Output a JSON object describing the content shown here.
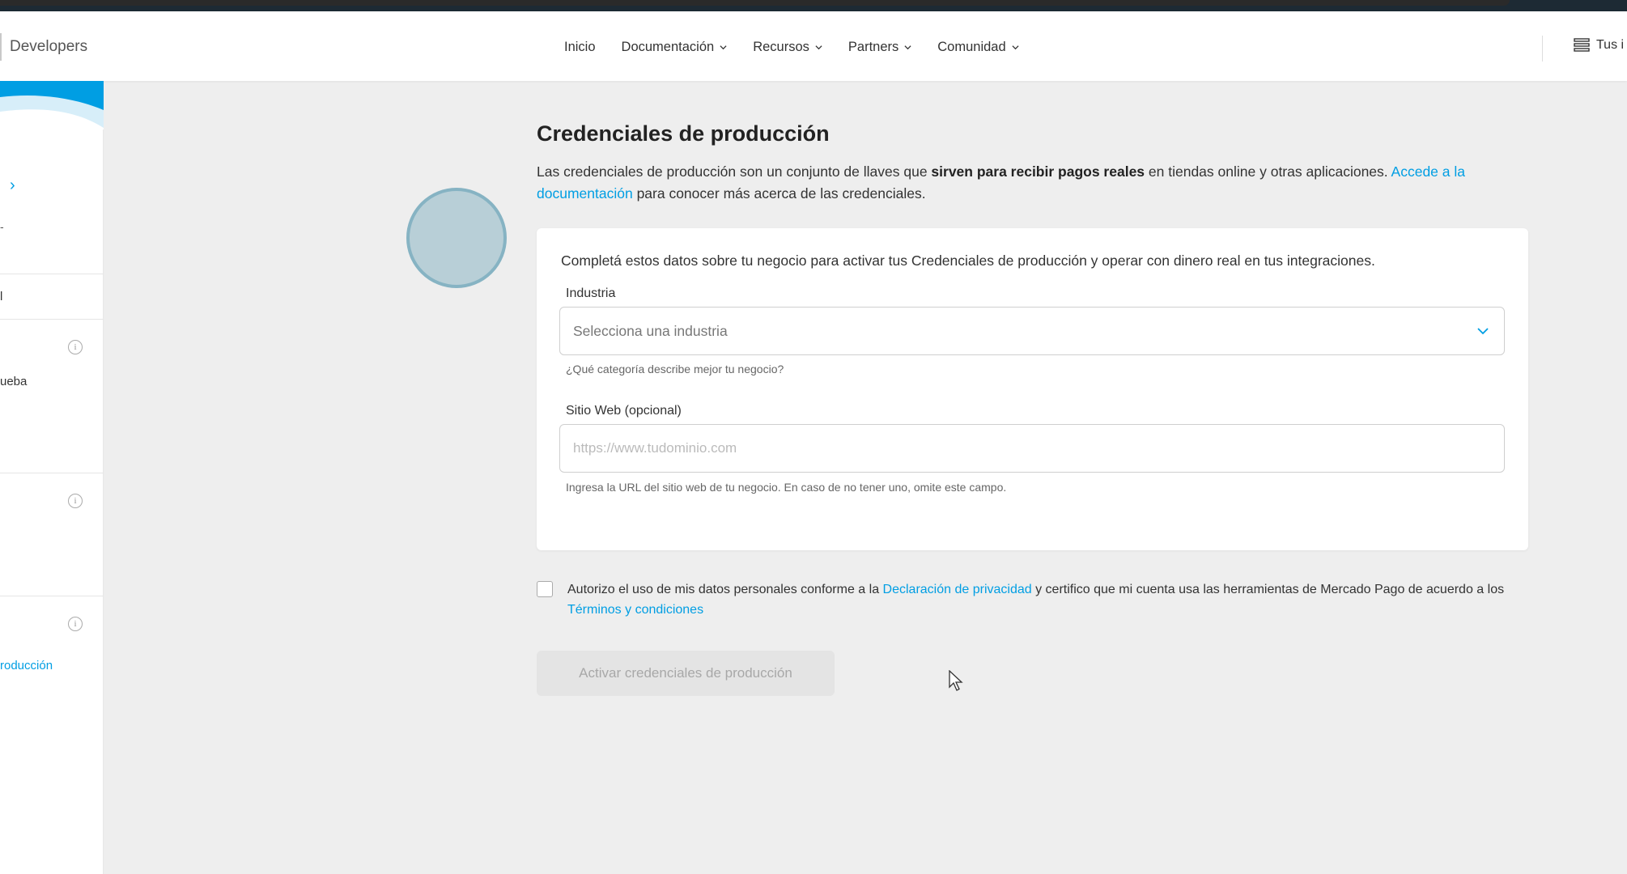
{
  "header": {
    "brand": "Developers",
    "nav": [
      {
        "label": "Inicio",
        "has_dropdown": false
      },
      {
        "label": "Documentación",
        "has_dropdown": true
      },
      {
        "label": "Recursos",
        "has_dropdown": true
      },
      {
        "label": "Partners",
        "has_dropdown": true
      },
      {
        "label": "Comunidad",
        "has_dropdown": true
      }
    ],
    "user_menu_label": "Tus i"
  },
  "sidebar": {
    "items": [
      {
        "text": "l"
      },
      {
        "text": "ueba"
      },
      {
        "text": "roducción"
      }
    ]
  },
  "main": {
    "title": "Credenciales de producción",
    "intro_part1": "Las credenciales de producción son un conjunto de llaves que ",
    "intro_bold": "sirven para recibir pagos reales",
    "intro_part2": " en tiendas online y otras aplicaciones. ",
    "intro_link": "Accede a la documentación",
    "intro_part3": " para conocer más acerca de las credenciales."
  },
  "form": {
    "intro": "Completá estos datos sobre tu negocio para activar tus Credenciales de producción y operar con dinero real en tus integraciones.",
    "industry_label": "Industria",
    "industry_placeholder": "Selecciona una industria",
    "industry_help": "¿Qué categoría describe mejor tu negocio?",
    "website_label": "Sitio Web (opcional)",
    "website_placeholder": "https://www.tudominio.com",
    "website_value": "",
    "website_help": "Ingresa la URL del sitio web de tu negocio. En caso de no tener uno, omite este campo."
  },
  "consent": {
    "checked": false,
    "text_part1": "Autorizo el uso de mis datos personales conforme a la ",
    "privacy_link": "Declaración de privacidad",
    "text_part2": " y certifico que mi cuenta usa las herramientas de Mercado Pago de acuerdo a los ",
    "terms_link": "Términos y condiciones"
  },
  "actions": {
    "activate_label": "Activar credenciales de producción",
    "activate_enabled": false
  },
  "colors": {
    "accent": "#009ee3",
    "background": "#eeeeee",
    "disabled_button": "#e4e4e4"
  }
}
